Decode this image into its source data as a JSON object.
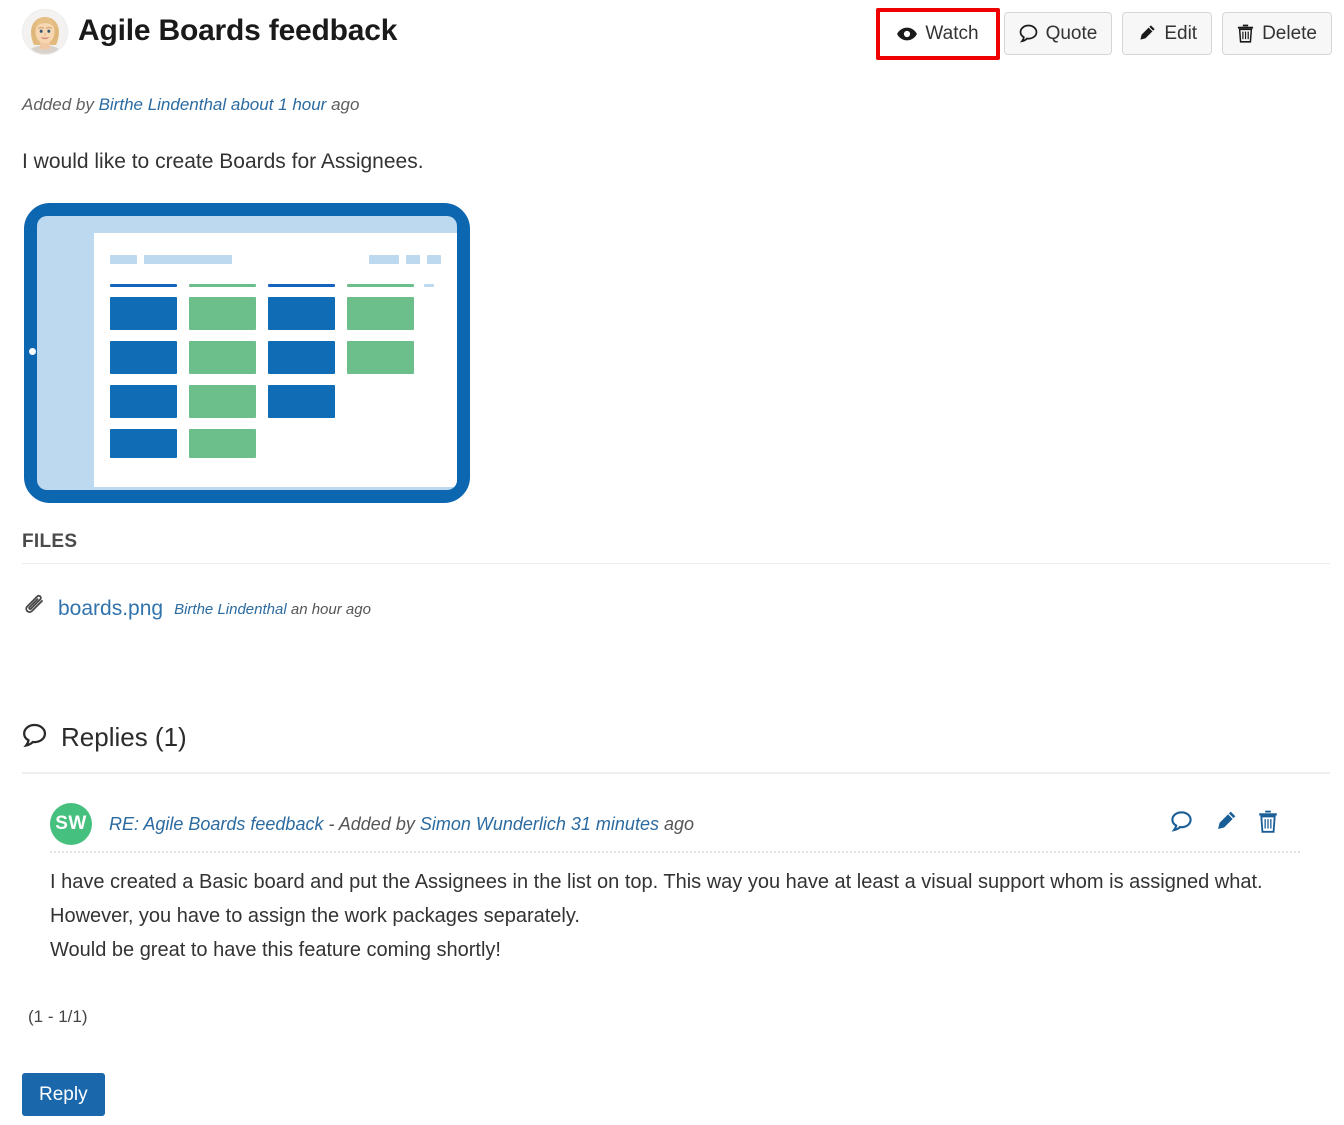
{
  "header": {
    "title": "Agile Boards feedback",
    "avatar_name": "user-photo-avatar",
    "toolbar": [
      {
        "label": "Watch",
        "icon": "eye-icon",
        "highlighted": true
      },
      {
        "label": "Quote",
        "icon": "comment-icon",
        "highlighted": false
      },
      {
        "label": "Edit",
        "icon": "pencil-icon",
        "highlighted": false
      },
      {
        "label": "Delete",
        "icon": "trash-icon",
        "highlighted": false
      }
    ]
  },
  "meta": {
    "prefix": "Added by ",
    "author": "Birthe Lindenthal",
    "time_link": " about 1 hour",
    "suffix": " ago"
  },
  "post": {
    "body": "I would like to create Boards for Assignees."
  },
  "illustration": {
    "name": "agile-board-tablet-illustration",
    "frame_color": "#0d66b0",
    "screen_bg_color": "#bcd9ef",
    "card_blue": "#0f6cb5",
    "card_green": "#6cbf8a",
    "header_bar_color": "#bcd9ef"
  },
  "files": {
    "section_title": "FILES",
    "items": [
      {
        "icon": "paperclip-icon",
        "name": "boards.png",
        "author": "Birthe Lindenthal",
        "time": " an hour ago"
      }
    ]
  },
  "replies": {
    "icon": "comment-icon",
    "heading": "Replies (1)",
    "items": [
      {
        "initials": "SW",
        "avatar_color": "#45c07e",
        "subject": "RE: Agile Boards feedback",
        "separator": " - Added by ",
        "author": "Simon Wunderlich",
        "time_link": " 31 minutes",
        "time_suffix": " ago",
        "actions": [
          {
            "icon": "comment-icon",
            "label": "Quote"
          },
          {
            "icon": "pencil-icon",
            "label": "Edit"
          },
          {
            "icon": "trash-icon",
            "label": "Delete"
          }
        ],
        "body_lines": [
          "I have created a Basic board and put the Assignees in the list on top. This way you have at least a visual support whom is assigned what.",
          "However, you have to assign the work packages separately.",
          "Would be great to have this feature coming shortly!"
        ]
      }
    ],
    "pagination": "(1 - 1/1)"
  },
  "footer": {
    "reply_button": "Reply"
  }
}
